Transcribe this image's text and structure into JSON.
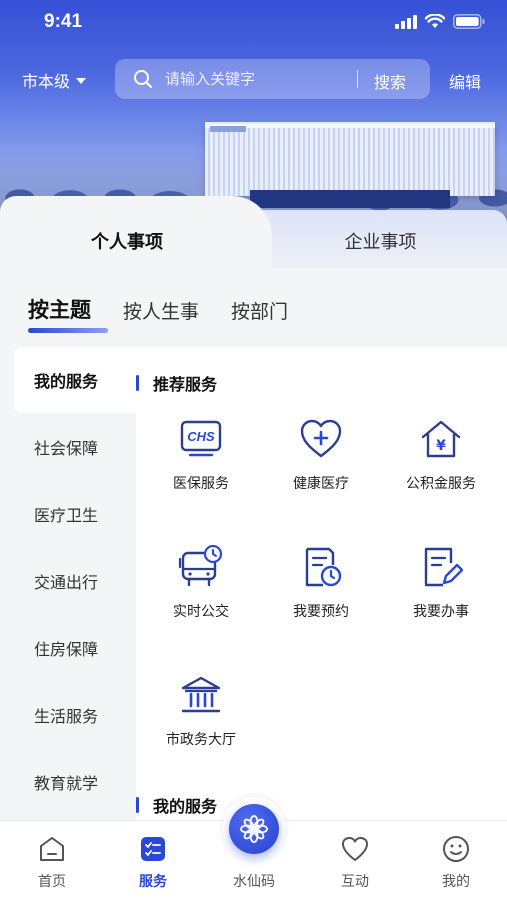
{
  "status_bar": {
    "time": "9:41"
  },
  "header": {
    "city_select": "市本级",
    "search_placeholder": "请输入关键字",
    "search_button": "搜索",
    "edit_link": "编辑"
  },
  "main_tabs": [
    {
      "label": "个人事项",
      "active": true
    },
    {
      "label": "企业事项",
      "active": false
    }
  ],
  "sub_tabs": [
    {
      "label": "按主题",
      "active": true
    },
    {
      "label": "按人生事",
      "active": false
    },
    {
      "label": "按部门",
      "active": false
    }
  ],
  "sidebar": {
    "items": [
      {
        "label": "我的服务",
        "active": true
      },
      {
        "label": "社会保障",
        "active": false
      },
      {
        "label": "医疗卫生",
        "active": false
      },
      {
        "label": "交通出行",
        "active": false
      },
      {
        "label": "住房保障",
        "active": false
      },
      {
        "label": "生活服务",
        "active": false
      },
      {
        "label": "教育就学",
        "active": false
      }
    ]
  },
  "content": {
    "recommended_title": "推荐服务",
    "my_services_title": "我的服务",
    "services": [
      {
        "label": "医保服务",
        "icon": "chs-badge-icon",
        "icon_text": "CHS"
      },
      {
        "label": "健康医疗",
        "icon": "heart-plus-icon"
      },
      {
        "label": "公积金服务",
        "icon": "house-yen-icon",
        "icon_text": "¥"
      },
      {
        "label": "实时公交",
        "icon": "bus-clock-icon"
      },
      {
        "label": "我要预约",
        "icon": "document-clock-icon"
      },
      {
        "label": "我要办事",
        "icon": "document-edit-icon"
      },
      {
        "label": "市政务大厅",
        "icon": "government-hall-icon"
      }
    ]
  },
  "bottom_nav": [
    {
      "label": "首页",
      "icon": "home-icon",
      "active": false
    },
    {
      "label": "服务",
      "icon": "service-list-icon",
      "active": true
    },
    {
      "label": "水仙码",
      "icon": "narcissus-flower-icon",
      "active": false
    },
    {
      "label": "互动",
      "icon": "heart-icon",
      "active": false
    },
    {
      "label": "我的",
      "icon": "smiley-face-icon",
      "active": false
    }
  ],
  "colors": {
    "accent": "#2948d6",
    "icon_stroke": "#2c3e8f",
    "page_bg": "#f4f5f7"
  }
}
